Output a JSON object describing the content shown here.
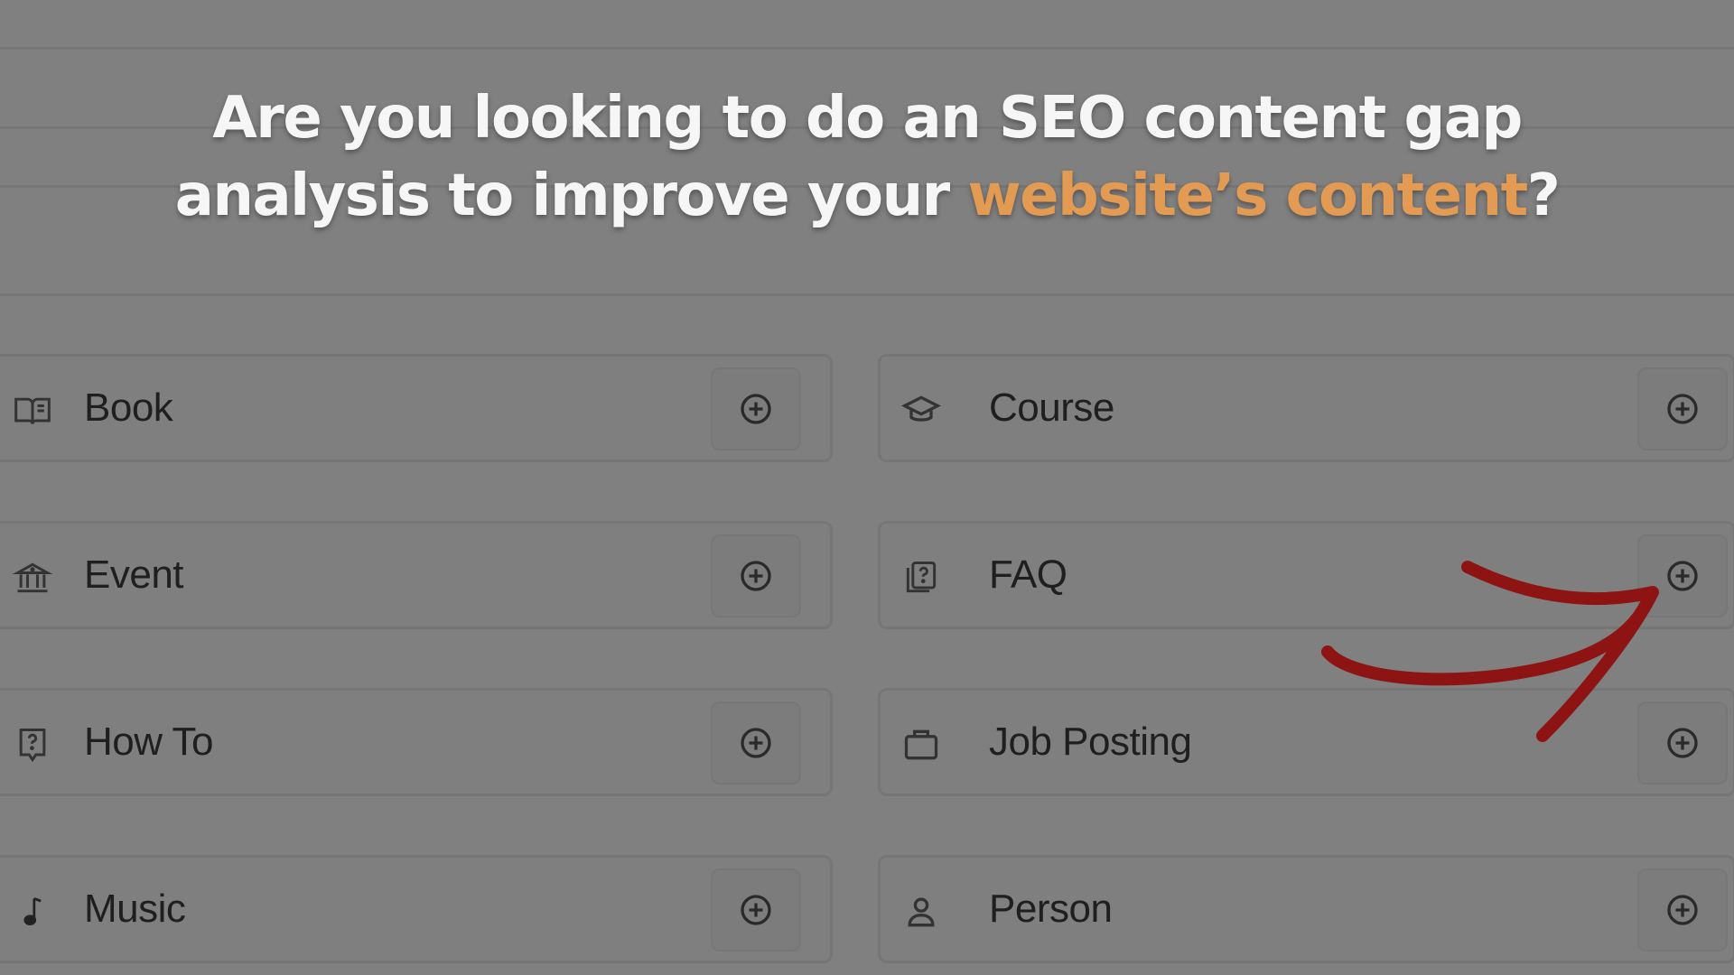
{
  "headline": {
    "line1": "Are you looking to do an SEO content gap",
    "line2_prefix": "analysis to improve your ",
    "line2_accent": "website’s content",
    "line2_suffix": "?"
  },
  "colors": {
    "accent": "#e39a52",
    "arrow": "#8e1414",
    "overlay_gray": "#808080"
  },
  "schema_types": [
    {
      "label": "Book",
      "icon": "open-book-icon"
    },
    {
      "label": "Course",
      "icon": "graduation-cap-icon"
    },
    {
      "label": "Event",
      "icon": "venue-building-icon"
    },
    {
      "label": "FAQ",
      "icon": "question-document-icon"
    },
    {
      "label": "How To",
      "icon": "question-note-icon"
    },
    {
      "label": "Job Posting",
      "icon": "briefcase-icon"
    },
    {
      "label": "Music",
      "icon": "music-note-icon"
    },
    {
      "label": "Person",
      "icon": "person-icon"
    }
  ]
}
